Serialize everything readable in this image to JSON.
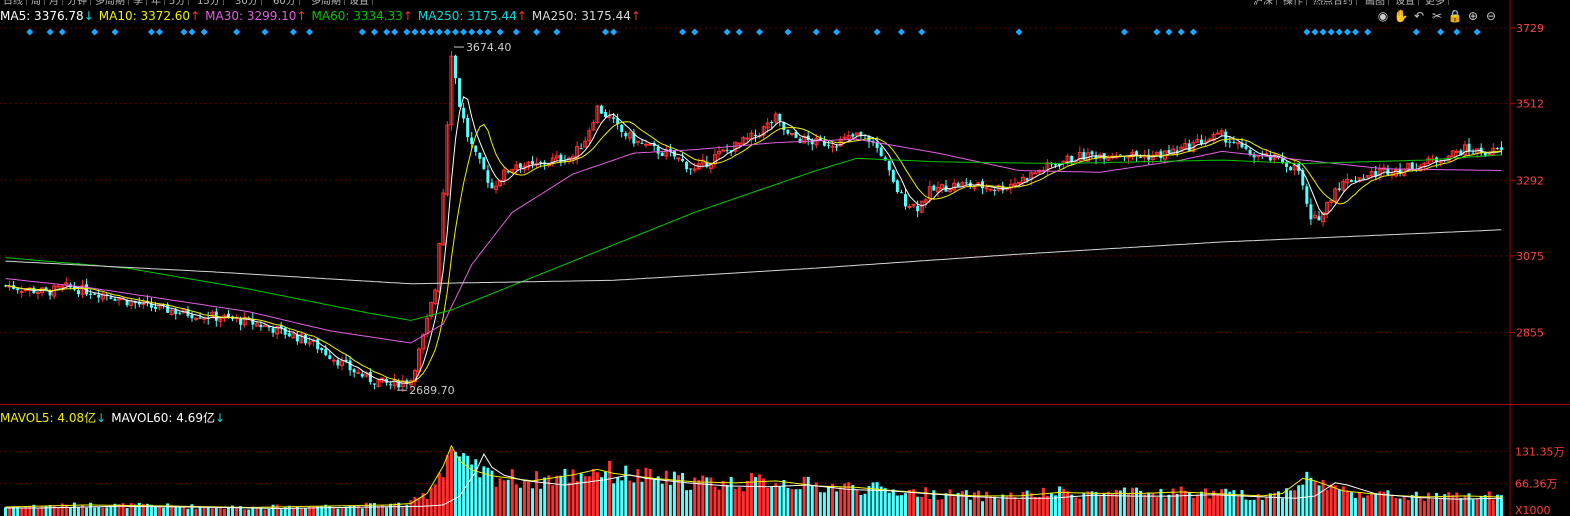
{
  "topbar": {
    "tabs": [
      "日线",
      "周",
      "月",
      "分钟",
      "多周期",
      "季",
      "年",
      "5分",
      "15分",
      "30分",
      "60分",
      "多周期",
      "设置"
    ],
    "right_tabs": [
      "沪深",
      "操作",
      "热点合约",
      "画图",
      "设置",
      "更多"
    ]
  },
  "legend": {
    "indicator": "MA",
    "items": [
      {
        "label": "MA5: 3376.78",
        "arrow": "↓",
        "color": "#ffffff",
        "arrow_color": "#00dcdc"
      },
      {
        "label": "MA10: 3372.60",
        "arrow": "↑",
        "color": "#f0f000",
        "arrow_color": "#ff3030"
      },
      {
        "label": "MA30: 3299.10",
        "arrow": "↑",
        "color": "#e060e0",
        "arrow_color": "#ff3030"
      },
      {
        "label": "MA60: 3334.33",
        "arrow": "↑",
        "color": "#00c800",
        "arrow_color": "#ff3030"
      },
      {
        "label": "MA250: 3175.44",
        "arrow": "↑",
        "color": "#00dcdc",
        "arrow_color": "#ff3030"
      },
      {
        "label": "MA250: 3175.44",
        "arrow": "↑",
        "color": "#d8d8d8",
        "arrow_color": "#ff3030"
      }
    ]
  },
  "tools": [
    "eye-icon",
    "hand-icon",
    "undo-icon",
    "scissors-icon",
    "lock-icon",
    "zoom-in-icon",
    "zoom-out-icon"
  ],
  "vol_legend": {
    "items": [
      {
        "label": "MAVOL5: 4.08亿",
        "arrow": "↓",
        "color": "#f0f000",
        "arrow_color": "#00dcdc"
      },
      {
        "label": "MAVOL60: 4.69亿",
        "arrow": "↓",
        "color": "#ffffff",
        "arrow_color": "#00dcdc"
      }
    ]
  },
  "colors": {
    "up": "#ff3030",
    "down": "#54ffff",
    "grid": "#6a0000",
    "axis_text": "#ff4040",
    "ma5": "#ffffff",
    "ma10": "#f0f000",
    "ma30": "#e060e0",
    "ma60": "#00c800",
    "ma250": "#d8d8d8",
    "signal": "#1aa8ff"
  },
  "chart_data": {
    "type": "candlestick",
    "price_axis": {
      "ticks": [
        3729,
        3512,
        3292,
        3075,
        2855
      ],
      "ylim": [
        2650,
        3729
      ]
    },
    "volume_axis": {
      "ticks": [
        "131.35万",
        "66.36万"
      ],
      "unit": "X1000",
      "ylim": [
        0,
        185
      ]
    },
    "annotations": [
      {
        "text": "3674.40",
        "value": 3674.4
      },
      {
        "text": "2689.70",
        "value": 2689.7
      }
    ],
    "trend": [
      [
        0,
        2990
      ],
      [
        5,
        2980
      ],
      [
        10,
        2970
      ],
      [
        15,
        2985
      ],
      [
        20,
        2975
      ],
      [
        25,
        2965
      ],
      [
        30,
        2945
      ],
      [
        35,
        2930
      ],
      [
        40,
        2920
      ],
      [
        45,
        2910
      ],
      [
        50,
        2902
      ],
      [
        55,
        2895
      ],
      [
        60,
        2885
      ],
      [
        65,
        2870
      ],
      [
        70,
        2850
      ],
      [
        75,
        2830
      ],
      [
        80,
        2790
      ],
      [
        85,
        2750
      ],
      [
        90,
        2720
      ],
      [
        95,
        2705
      ],
      [
        100,
        2720
      ],
      [
        103,
        2840
      ],
      [
        106,
        2980
      ],
      [
        108,
        3260
      ],
      [
        110,
        3660
      ],
      [
        112,
        3510
      ],
      [
        114,
        3420
      ],
      [
        116,
        3360
      ],
      [
        118,
        3320
      ],
      [
        120,
        3270
      ],
      [
        122,
        3300
      ],
      [
        126,
        3340
      ],
      [
        130,
        3330
      ],
      [
        135,
        3350
      ],
      [
        140,
        3360
      ],
      [
        143,
        3410
      ],
      [
        146,
        3500
      ],
      [
        149,
        3470
      ],
      [
        152,
        3430
      ],
      [
        156,
        3400
      ],
      [
        160,
        3380
      ],
      [
        165,
        3360
      ],
      [
        170,
        3320
      ],
      [
        175,
        3360
      ],
      [
        180,
        3390
      ],
      [
        185,
        3420
      ],
      [
        190,
        3470
      ],
      [
        193,
        3420
      ],
      [
        196,
        3410
      ],
      [
        200,
        3400
      ],
      [
        205,
        3400
      ],
      [
        210,
        3420
      ],
      [
        213,
        3410
      ],
      [
        216,
        3370
      ],
      [
        219,
        3280
      ],
      [
        222,
        3230
      ],
      [
        225,
        3215
      ],
      [
        228,
        3260
      ],
      [
        231,
        3270
      ],
      [
        235,
        3280
      ],
      [
        240,
        3275
      ],
      [
        245,
        3270
      ],
      [
        250,
        3290
      ],
      [
        255,
        3320
      ],
      [
        260,
        3345
      ],
      [
        265,
        3360
      ],
      [
        270,
        3365
      ],
      [
        275,
        3370
      ],
      [
        280,
        3360
      ],
      [
        285,
        3365
      ],
      [
        290,
        3380
      ],
      [
        295,
        3405
      ],
      [
        300,
        3420
      ],
      [
        303,
        3400
      ],
      [
        306,
        3370
      ],
      [
        310,
        3360
      ],
      [
        315,
        3345
      ],
      [
        319,
        3320
      ],
      [
        322,
        3170
      ],
      [
        325,
        3200
      ],
      [
        328,
        3270
      ],
      [
        332,
        3295
      ],
      [
        336,
        3305
      ],
      [
        340,
        3320
      ],
      [
        345,
        3325
      ],
      [
        350,
        3340
      ],
      [
        355,
        3360
      ],
      [
        360,
        3380
      ],
      [
        365,
        3370
      ],
      [
        369,
        3378
      ]
    ],
    "ma_trend": {
      "ma30": [
        [
          0,
          3010
        ],
        [
          20,
          2985
        ],
        [
          40,
          2950
        ],
        [
          60,
          2915
        ],
        [
          80,
          2860
        ],
        [
          100,
          2825
        ],
        [
          108,
          2880
        ],
        [
          115,
          3050
        ],
        [
          125,
          3200
        ],
        [
          140,
          3310
        ],
        [
          155,
          3370
        ],
        [
          170,
          3380
        ],
        [
          190,
          3400
        ],
        [
          210,
          3410
        ],
        [
          230,
          3370
        ],
        [
          250,
          3320
        ],
        [
          270,
          3315
        ],
        [
          290,
          3350
        ],
        [
          300,
          3375
        ],
        [
          320,
          3350
        ],
        [
          340,
          3325
        ],
        [
          369,
          3320
        ]
      ],
      "ma60": [
        [
          0,
          3070
        ],
        [
          30,
          3040
        ],
        [
          60,
          2980
        ],
        [
          90,
          2910
        ],
        [
          100,
          2890
        ],
        [
          110,
          2920
        ],
        [
          140,
          3060
        ],
        [
          170,
          3200
        ],
        [
          200,
          3320
        ],
        [
          210,
          3355
        ],
        [
          230,
          3345
        ],
        [
          260,
          3340
        ],
        [
          300,
          3350
        ],
        [
          320,
          3340
        ],
        [
          350,
          3350
        ],
        [
          369,
          3365
        ]
      ],
      "ma250": [
        [
          0,
          3060
        ],
        [
          50,
          3030
        ],
        [
          100,
          2995
        ],
        [
          150,
          3005
        ],
        [
          200,
          3040
        ],
        [
          250,
          3080
        ],
        [
          300,
          3115
        ],
        [
          350,
          3140
        ],
        [
          369,
          3150
        ]
      ]
    },
    "volume_trend": [
      [
        0,
        18
      ],
      [
        20,
        22
      ],
      [
        40,
        20
      ],
      [
        60,
        17
      ],
      [
        80,
        20
      ],
      [
        95,
        22
      ],
      [
        100,
        25
      ],
      [
        104,
        45
      ],
      [
        108,
        100
      ],
      [
        110,
        140
      ],
      [
        112,
        110
      ],
      [
        115,
        92
      ],
      [
        120,
        80
      ],
      [
        130,
        70
      ],
      [
        140,
        82
      ],
      [
        146,
        93
      ],
      [
        150,
        85
      ],
      [
        160,
        75
      ],
      [
        170,
        68
      ],
      [
        180,
        66
      ],
      [
        190,
        70
      ],
      [
        200,
        60
      ],
      [
        210,
        57
      ],
      [
        220,
        50
      ],
      [
        230,
        44
      ],
      [
        240,
        40
      ],
      [
        250,
        40
      ],
      [
        260,
        47
      ],
      [
        270,
        45
      ],
      [
        280,
        45
      ],
      [
        290,
        48
      ],
      [
        300,
        44
      ],
      [
        310,
        40
      ],
      [
        315,
        45
      ],
      [
        320,
        75
      ],
      [
        323,
        70
      ],
      [
        330,
        50
      ],
      [
        340,
        42
      ],
      [
        350,
        38
      ],
      [
        360,
        40
      ],
      [
        369,
        38
      ]
    ],
    "bars": 370
  }
}
